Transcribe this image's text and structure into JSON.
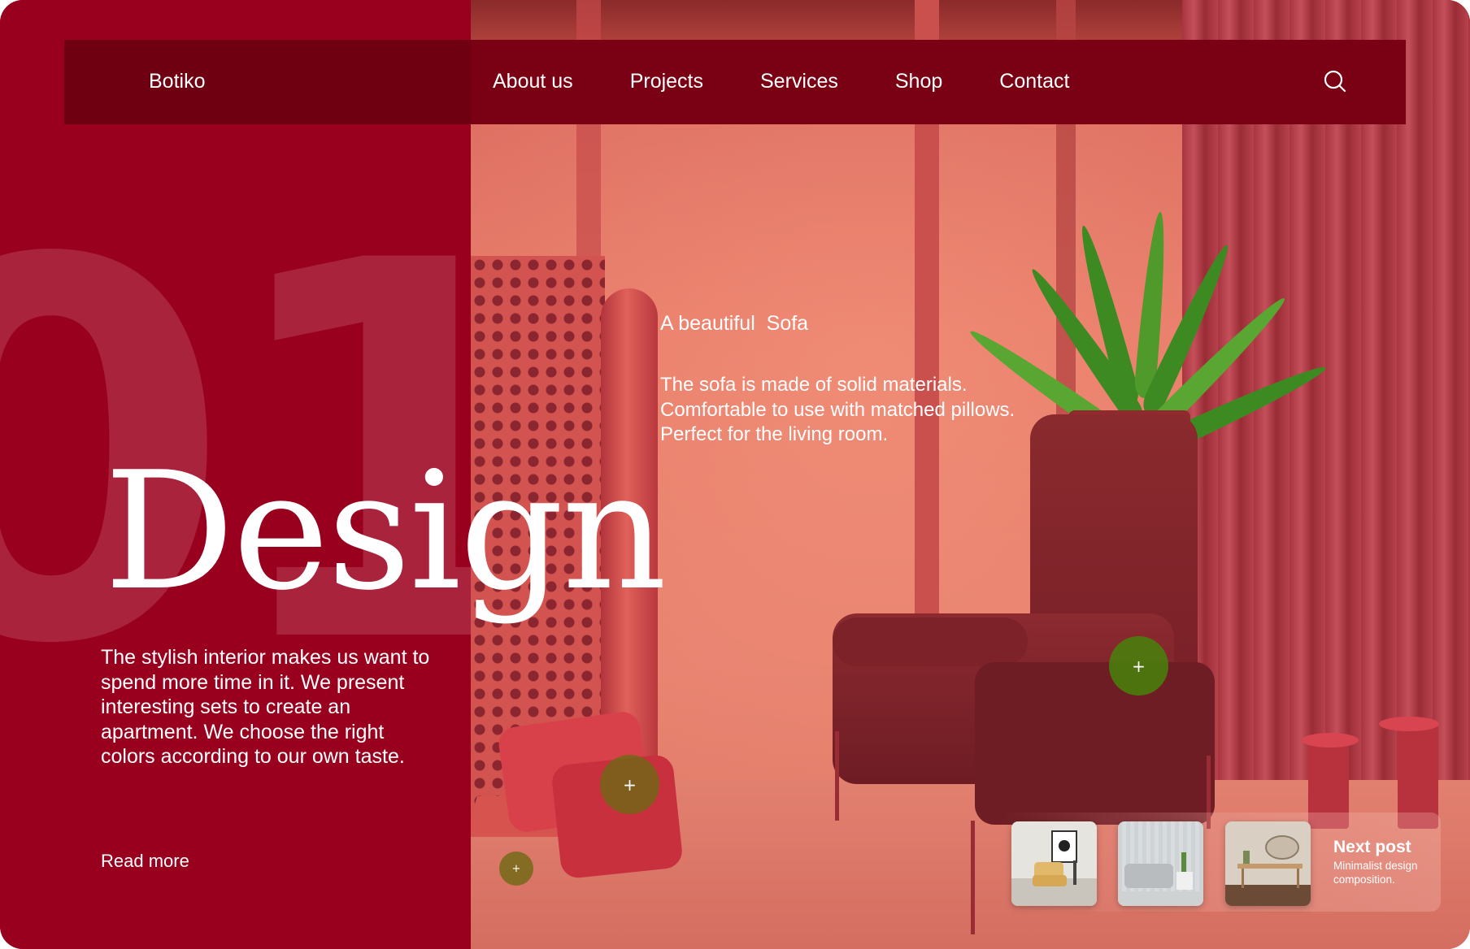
{
  "nav": {
    "brand": "Botiko",
    "links": [
      "About us",
      "Projects",
      "Services",
      "Shop",
      "Contact"
    ],
    "search_icon": "search-icon"
  },
  "hero": {
    "number": "01",
    "headline": "Design",
    "intro": "The stylish interior makes us want to spend more time in it. We present interesting sets to create an apartment. We choose the right colors according to our own taste.",
    "read_more": "Read more"
  },
  "product": {
    "title": "A beautiful  Sofa",
    "description_lines": [
      "The sofa is made of solid materials.",
      "Comfortable to use with matched pillows.",
      "Perfect for the living room."
    ]
  },
  "hotspots": [
    {
      "label": "+"
    },
    {
      "label": "+"
    },
    {
      "label": "+"
    }
  ],
  "next_post": {
    "title": "Next post",
    "subtitle": "Minimalist design composition.",
    "thumbnails": [
      "armchair-room",
      "sofa-room",
      "desk-room"
    ]
  },
  "colors": {
    "primary_red": "#98001e",
    "nav_red": "#7a0014",
    "hotspot_green": "#46820a"
  }
}
